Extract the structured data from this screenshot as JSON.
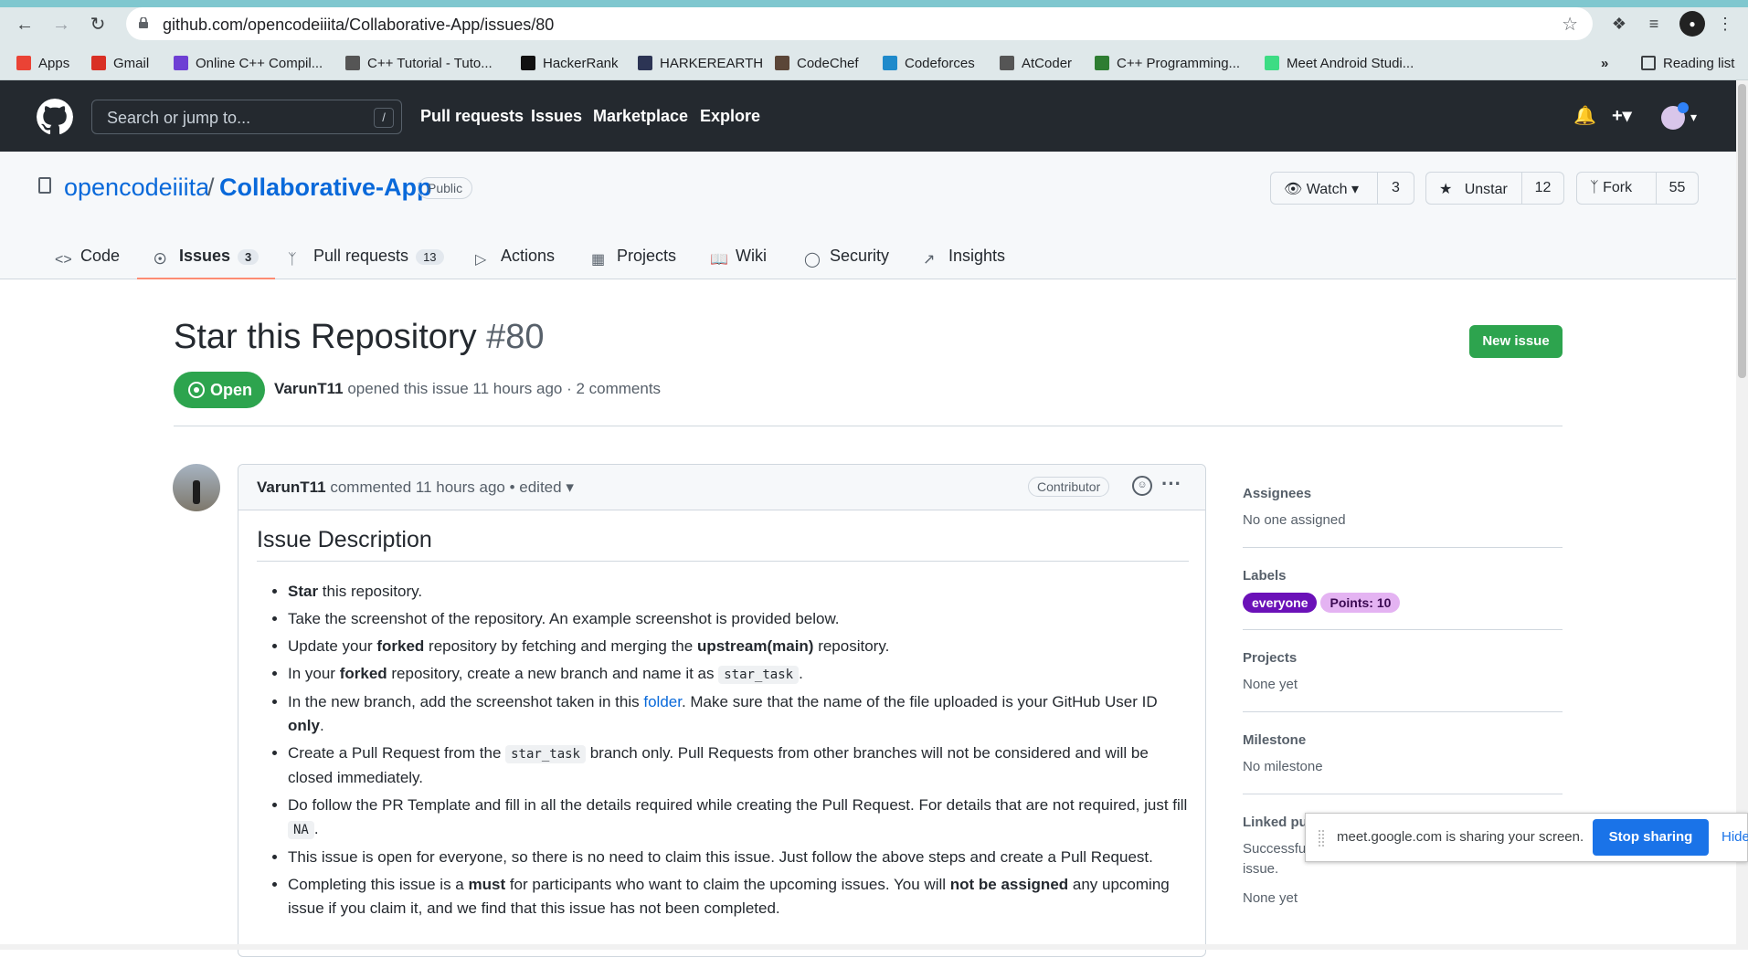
{
  "browser": {
    "url": "github.com/opencodeiiita/Collaborative-App/issues/80",
    "bookmarks": [
      {
        "label": "Apps",
        "icon": "apps-grid-icon",
        "color": "#ea4335"
      },
      {
        "label": "Gmail",
        "icon": "gmail-icon",
        "color": "#d93025"
      },
      {
        "label": "Online C++ Compil...",
        "icon": "bolt-icon",
        "color": "#6e3fd4"
      },
      {
        "label": "C++ Tutorial - Tuto...",
        "icon": "diamond-icon",
        "color": "#555555"
      },
      {
        "label": "HackerRank",
        "icon": "hackerrank-icon",
        "color": "#111111"
      },
      {
        "label": "HARKEREARTH",
        "icon": "hackerearth-icon",
        "color": "#2c3454"
      },
      {
        "label": "CodeChef",
        "icon": "codechef-icon",
        "color": "#5b4638"
      },
      {
        "label": "Codeforces",
        "icon": "codeforces-icon",
        "color": "#1f8acb"
      },
      {
        "label": "AtCoder",
        "icon": "atcoder-icon",
        "color": "#555555"
      },
      {
        "label": "C++ Programming...",
        "icon": "link-icon",
        "color": "#2e7d32"
      },
      {
        "label": "Meet Android Studi...",
        "icon": "android-icon",
        "color": "#3ddc84"
      }
    ],
    "reading_list": "Reading list"
  },
  "gh": {
    "search_placeholder": "Search or jump to...",
    "search_key": "/",
    "nav": [
      "Pull requests",
      "Issues",
      "Marketplace",
      "Explore"
    ]
  },
  "repo": {
    "owner": "opencodeiiita",
    "sep": "/",
    "name": "Collaborative-App",
    "visibility": "Public",
    "watch": {
      "label": "Watch",
      "count": "3"
    },
    "star": {
      "label": "Unstar",
      "count": "12"
    },
    "fork": {
      "label": "Fork",
      "count": "55"
    },
    "tabs": [
      {
        "label": "Code",
        "icon": "code-icon",
        "counter": ""
      },
      {
        "label": "Issues",
        "icon": "issue-opened-icon",
        "counter": "3"
      },
      {
        "label": "Pull requests",
        "icon": "git-pull-request-icon",
        "counter": "13"
      },
      {
        "label": "Actions",
        "icon": "play-icon",
        "counter": ""
      },
      {
        "label": "Projects",
        "icon": "project-icon",
        "counter": ""
      },
      {
        "label": "Wiki",
        "icon": "book-icon",
        "counter": ""
      },
      {
        "label": "Security",
        "icon": "shield-icon",
        "counter": ""
      },
      {
        "label": "Insights",
        "icon": "graph-icon",
        "counter": ""
      }
    ]
  },
  "issue": {
    "title": "Star this Repository",
    "number": "#80",
    "new_issue": "New issue",
    "state": "Open",
    "author": "VarunT11",
    "opened_text": "opened this issue 11 hours ago · 2 comments",
    "comment": {
      "author": "VarunT11",
      "time_text": "commented 11 hours ago • edited",
      "role": "Contributor",
      "heading": "Issue Description",
      "items": [
        {
          "b1": "Star",
          "t1": " this repository."
        },
        {
          "t1": "Take the screenshot of the repository. An example screenshot is provided below."
        },
        {
          "t1": "Update your ",
          "b1": "forked",
          "t2": " repository by fetching and merging the ",
          "b2": "upstream(main)",
          "t3": " repository."
        },
        {
          "t1": "In your ",
          "b1": "forked",
          "t2": " repository, create a new branch and name it as ",
          "code": "star_task",
          "t3": "."
        },
        {
          "t1": "In the new branch, add the screenshot taken in this ",
          "link": "folder",
          "t2": ". Make sure that the name of the file uploaded is your GitHub User ID ",
          "b1": "only",
          "t3": "."
        },
        {
          "t1": "Create a Pull Request from the ",
          "code": "star_task",
          "t2": " branch only. Pull Requests from other branches will not be considered and will be closed immediately."
        },
        {
          "t1": "Do follow the PR Template and fill in all the details required while creating the Pull Request. For details that are not required, just fill ",
          "code": "NA",
          "t2": "."
        },
        {
          "t1": "This issue is open for everyone, so there is no need to claim this issue. Just follow the above steps and create a Pull Request."
        },
        {
          "t1": "Completing this issue is a ",
          "b1": "must",
          "t2": " for participants who want to claim the upcoming issues. You will ",
          "b2": "not be assigned",
          "t3": " any upcoming issue if you claim it, and we find that this issue has not been completed."
        }
      ]
    }
  },
  "sidebar": {
    "assignees": {
      "title": "Assignees",
      "value": "No one assigned"
    },
    "labels": {
      "title": "Labels",
      "items": [
        {
          "name": "everyone",
          "bg": "#6b11b8",
          "fg": "#ffffff"
        },
        {
          "name": "Points: 10",
          "bg": "#e4b3f2",
          "fg": "#3b0a52"
        }
      ]
    },
    "projects": {
      "title": "Projects",
      "value": "None yet"
    },
    "milestone": {
      "title": "Milestone",
      "value": "No milestone"
    },
    "linked": {
      "title": "Linked pull requests",
      "value": "Successfully merging a pull request may close this issue.",
      "value2": "None yet"
    }
  },
  "share_bar": {
    "text": "meet.google.com is sharing your screen.",
    "stop": "Stop sharing",
    "hide": "Hide"
  }
}
